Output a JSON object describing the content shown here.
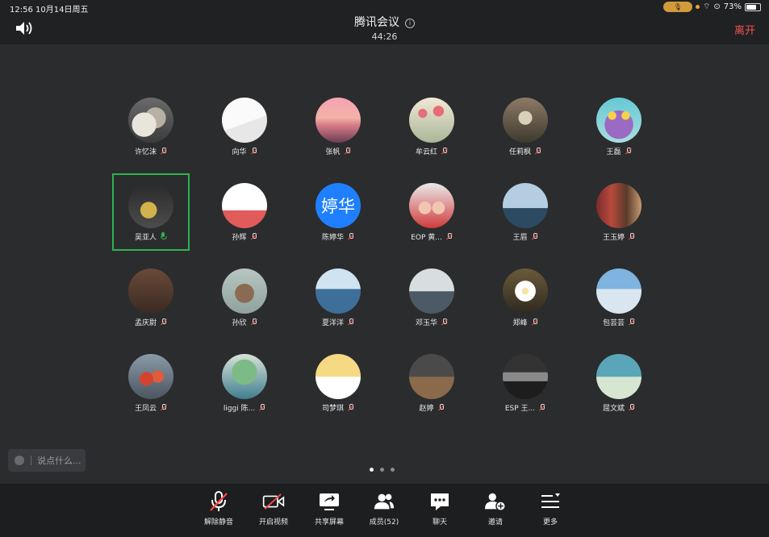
{
  "status": {
    "time_date": "12:56  10月14日周五",
    "battery": "73%",
    "battery_level": 0.73
  },
  "header": {
    "title": "腾讯会议",
    "timer": "44:26",
    "leave": "离开"
  },
  "participants": [
    {
      "name": "许忆沫",
      "mic": "muted",
      "avatar": "cat"
    },
    {
      "name": "向华",
      "mic": "muted",
      "avatar": "sketch"
    },
    {
      "name": "张帆",
      "mic": "muted",
      "avatar": "sunset"
    },
    {
      "name": "牟云红",
      "mic": "muted",
      "avatar": "flowers"
    },
    {
      "name": "任莉枫",
      "mic": "muted",
      "avatar": "vintage"
    },
    {
      "name": "王磊",
      "mic": "muted",
      "avatar": "owl"
    },
    {
      "name": "吴亚人",
      "mic": "on",
      "avatar": "dark-photo",
      "active": true
    },
    {
      "name": "孙辉",
      "mic": "muted",
      "avatar": "cartoon"
    },
    {
      "name": "陈婷华",
      "mic": "muted",
      "avatar": "text",
      "avatar_text": "婷华"
    },
    {
      "name": "EOP 黄...",
      "mic": "muted",
      "avatar": "kids"
    },
    {
      "name": "王眉",
      "mic": "muted",
      "avatar": "boat"
    },
    {
      "name": "王玉婷",
      "mic": "muted",
      "avatar": "bookshelf"
    },
    {
      "name": "孟庆尉",
      "mic": "muted",
      "avatar": "brown"
    },
    {
      "name": "孙欣",
      "mic": "muted",
      "avatar": "girl-drawing"
    },
    {
      "name": "夏洋洋",
      "mic": "muted",
      "avatar": "coast"
    },
    {
      "name": "邓玉华",
      "mic": "muted",
      "avatar": "lighthouse"
    },
    {
      "name": "郑峰",
      "mic": "muted",
      "avatar": "plumeria"
    },
    {
      "name": "包芸芸",
      "mic": "muted",
      "avatar": "beach"
    },
    {
      "name": "王凤云",
      "mic": "muted",
      "avatar": "apples"
    },
    {
      "name": "liggi 陈...",
      "mic": "muted",
      "avatar": "tree"
    },
    {
      "name": "司梦琪",
      "mic": "muted",
      "avatar": "masked"
    },
    {
      "name": "赵婷",
      "mic": "muted",
      "avatar": "room"
    },
    {
      "name": "ESP 王...",
      "mic": "muted",
      "avatar": "sea"
    },
    {
      "name": "屈文斌",
      "mic": "muted",
      "avatar": "river"
    }
  ],
  "chat": {
    "placeholder": "说点什么..."
  },
  "pager": {
    "pages": 3,
    "current": 1
  },
  "toolbar": {
    "unmute": "解除静音",
    "video": "开启视频",
    "share": "共享屏幕",
    "members": "成员(52)",
    "chat": "聊天",
    "invite": "邀请",
    "more": "更多"
  },
  "colors": {
    "accent_green": "#2fb34f",
    "leave_red": "#f0534f",
    "mute_red": "#ff4a4a"
  }
}
